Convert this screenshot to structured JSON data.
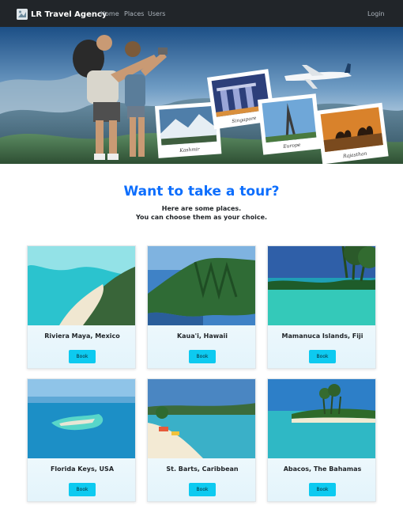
{
  "navbar": {
    "brand": "LR Travel Agency",
    "links": [
      {
        "label": "Home"
      },
      {
        "label": "Places"
      },
      {
        "label": "Users"
      }
    ],
    "login_label": "Login",
    "brand_icon": "logo-icon"
  },
  "hero": {
    "polaroids": [
      "Kashmir",
      "Singapore",
      "Europe",
      "Rajasthan"
    ]
  },
  "main": {
    "title": "Want to take a tour?",
    "subtitle_line1": "Here are some places.",
    "subtitle_line2": "You can choose them as your choice."
  },
  "cards": [
    {
      "name": "Riviera Maya, Mexico",
      "button": "Book"
    },
    {
      "name": "Kaua'i, Hawaii",
      "button": "Book"
    },
    {
      "name": "Mamanuca Islands, Fiji",
      "button": "Book"
    },
    {
      "name": "Florida Keys, USA",
      "button": "Book"
    },
    {
      "name": "St. Barts, Caribbean",
      "button": "Book"
    },
    {
      "name": "Abacos, The Bahamas",
      "button": "Book"
    }
  ],
  "colors": {
    "navbar_bg": "#212529",
    "title_blue": "#0d6efd",
    "button_cyan": "#0dcaf0"
  }
}
